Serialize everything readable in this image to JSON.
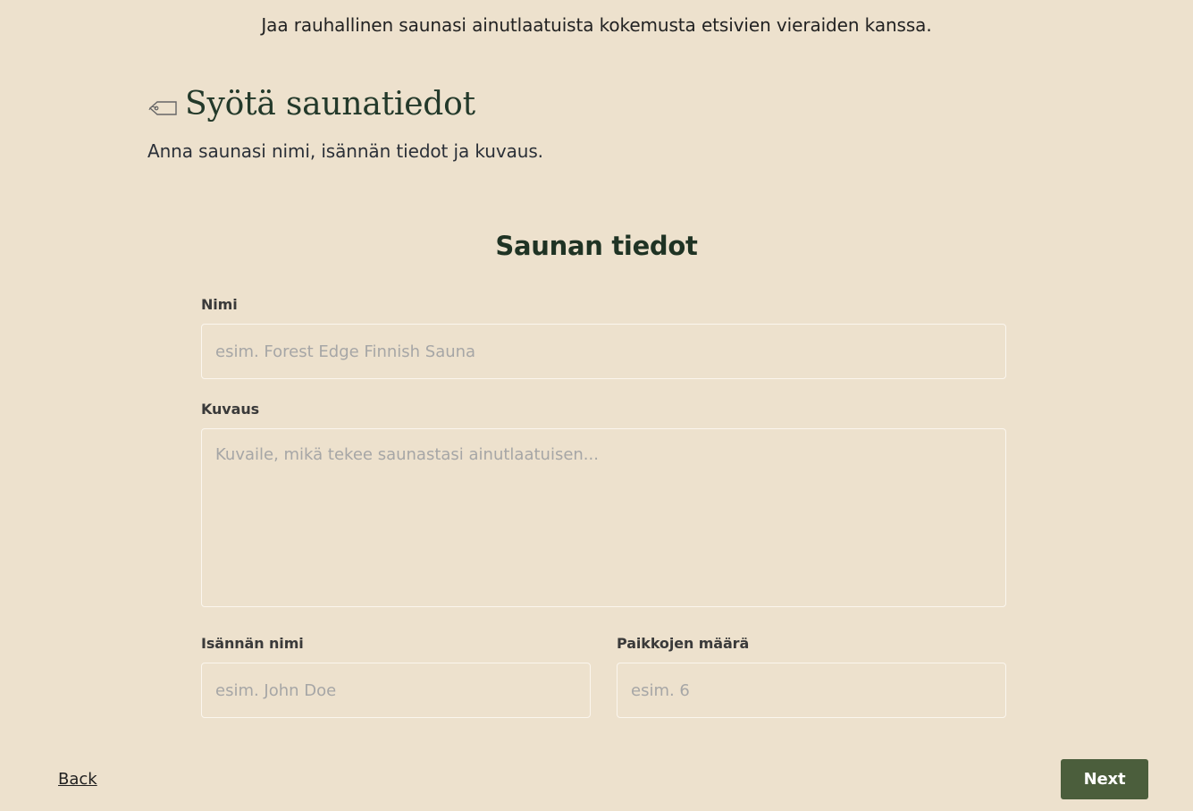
{
  "header": {
    "subtitle": "Jaa rauhallinen saunasi ainutlaatuista kokemusta etsivien vieraiden kanssa."
  },
  "step": {
    "icon": "tag-icon",
    "title": "Syötä saunatiedot",
    "description": "Anna saunasi nimi, isännän tiedot ja kuvaus."
  },
  "form": {
    "section_title": "Saunan tiedot",
    "name": {
      "label": "Nimi",
      "value": "",
      "placeholder": "esim. Forest Edge Finnish Sauna"
    },
    "description": {
      "label": "Kuvaus",
      "value": "",
      "placeholder": "Kuvaile, mikä tekee saunastasi ainutlaatuisen..."
    },
    "host_name": {
      "label": "Isännän nimi",
      "value": "",
      "placeholder": "esim. John Doe"
    },
    "seats": {
      "label": "Paikkojen määrä",
      "value": "",
      "placeholder": "esim. 6"
    }
  },
  "nav": {
    "back_label": "Back",
    "next_label": "Next"
  },
  "colors": {
    "background": "#ede1cd",
    "primary_button": "#4b5e3c",
    "heading": "#23392a"
  }
}
